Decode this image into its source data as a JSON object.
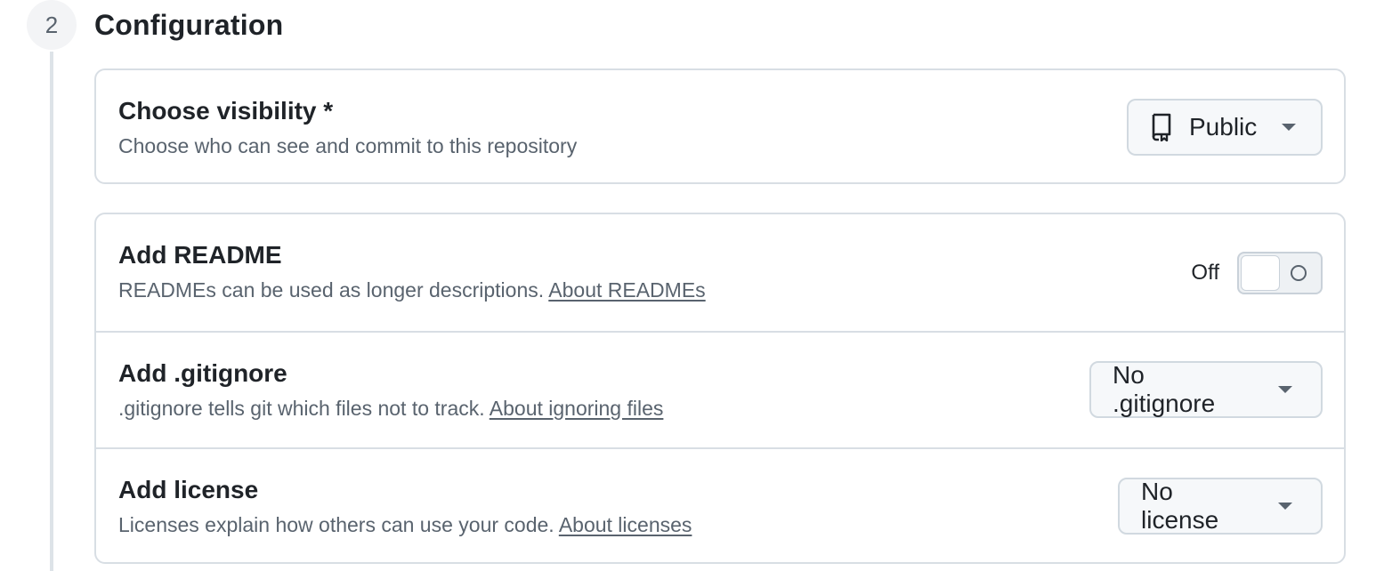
{
  "step": {
    "number": "2",
    "title": "Configuration"
  },
  "visibility": {
    "title": "Choose visibility *",
    "description": "Choose who can see and commit to this repository",
    "selected": "Public",
    "icon": "repo-icon"
  },
  "readme": {
    "title": "Add README",
    "description": "READMEs can be used as longer descriptions.",
    "link": "About READMEs",
    "toggle_state": "Off"
  },
  "gitignore": {
    "title": "Add .gitignore",
    "description": ".gitignore tells git which files not to track.",
    "link": "About ignoring files",
    "selected": "No .gitignore"
  },
  "license": {
    "title": "Add license",
    "description": "Licenses explain how others can use your code.",
    "link": "About licenses",
    "selected": "No license"
  }
}
